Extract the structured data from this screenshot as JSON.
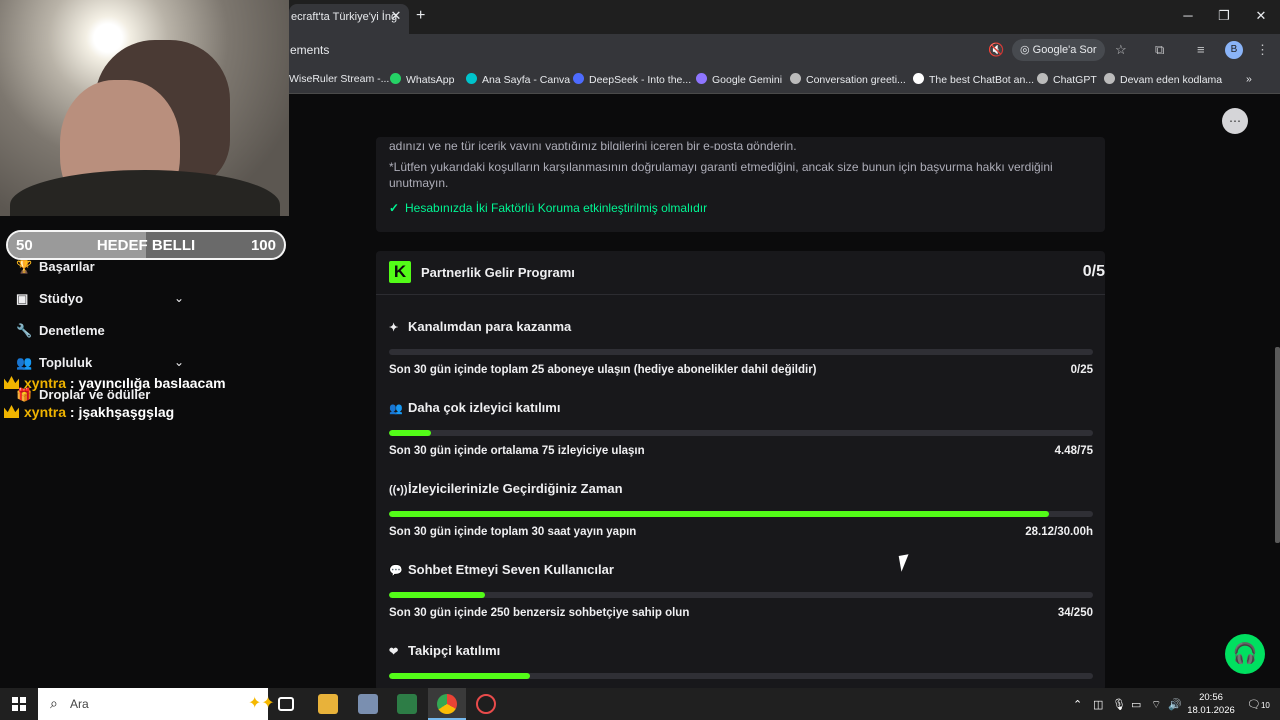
{
  "browser": {
    "tab_title": "ecraft'ta Türkiye'yi İng",
    "url_partial": "ements",
    "ask_google": "Google'a Sor",
    "profile_initial": "B",
    "bookmarks": [
      "WiseRuler Stream -...",
      "WhatsApp",
      "Ana Sayfa - Canva",
      "DeepSeek - Into the...",
      "Google Gemini",
      "Conversation greeti...",
      "The best ChatBot an...",
      "ChatGPT",
      "Devam eden kodlama"
    ]
  },
  "overlay": {
    "goal": {
      "min": "50",
      "title": "HEDEF BELLI",
      "max": "100",
      "progress_fraction": 0.5
    },
    "chat": [
      {
        "user": "xyntra",
        "message": ": yayıncılığa baslaacam"
      },
      {
        "user": "xyntra",
        "message": ": jşakhşaşgşlag"
      }
    ]
  },
  "sidebar": {
    "items": [
      {
        "label": "Başarılar"
      },
      {
        "label": "Stüdyo"
      },
      {
        "label": "Denetleme"
      },
      {
        "label": "Topluluk"
      },
      {
        "label": "Droplar ve ödüller"
      }
    ]
  },
  "top_card": {
    "line1": "adınızı ve ne tür içerik yayını yaptığınız bilgilerini içeren bir e-posta gönderin.",
    "line2": "*Lütfen yukarıdaki koşulların karşılanmasının doğrulamayı garanti etmediğini, ancak size bunun için başvurma hakkı verdiğini",
    "line3": "unutmayın.",
    "requirement": "Hesabınızda İki Faktörlü Koruma etkinleştirilmiş olmalıdır"
  },
  "partner": {
    "logo_letter": "K",
    "title": "Partnerlik Gelir Programı",
    "count": "0/5",
    "requirements": [
      {
        "title": "Kanalımdan para kazanma",
        "icon": "sparkle-icon",
        "desc": "Son 30 gün içinde toplam 25 aboneye ulaşın (hediye abonelikler dahil değildir)",
        "value": "0/25",
        "progress": 0.0
      },
      {
        "title": "Daha çok izleyici katılımı",
        "icon": "viewers-icon",
        "desc": "Son 30 gün içinde ortalama 75 izleyiciye ulaşın",
        "value": "4.48/75",
        "progress": 0.06
      },
      {
        "title": "İzleyicilerinizle Geçirdiğiniz Zaman",
        "icon": "broadcast-icon",
        "desc": "Son 30 gün içinde toplam 30 saat yayın yapın",
        "value": "28.12/30.00h",
        "progress": 0.937
      },
      {
        "title": "Sohbet Etmeyi Seven Kullanıcılar",
        "icon": "chat-bubble-icon",
        "desc": "Son 30 gün içinde 250 benzersiz sohbetçiye sahip olun",
        "value": "34/250",
        "progress": 0.136
      },
      {
        "title": "Takipçi katılımı",
        "icon": "heart-icon",
        "desc": "",
        "value": "",
        "progress": 0.2
      }
    ]
  },
  "taskbar": {
    "search_placeholder": "Ara",
    "time": "20:56",
    "date": "18.01.2026",
    "notifications": "10"
  },
  "colors": {
    "accent": "#53fc18",
    "check": "#00f593",
    "crown": "#f0b400"
  }
}
